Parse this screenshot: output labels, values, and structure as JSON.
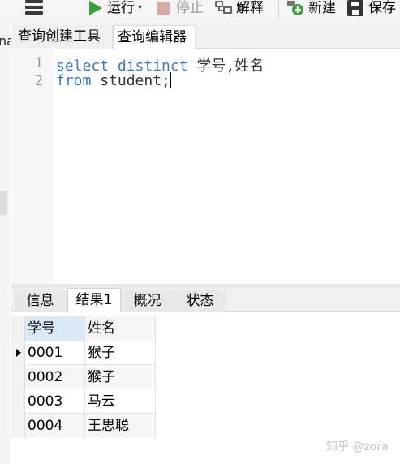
{
  "toolbar": {
    "run_label": "运行",
    "stop_label": "停止",
    "explain_label": "解释",
    "new_label": "新建",
    "save_label": "保存",
    "icons": [
      "menu-icon",
      "run-icon",
      "dropdown-caret-icon",
      "stop-icon",
      "explain-icon",
      "new-icon",
      "save-icon"
    ],
    "colors": {
      "run": "#3aa23a",
      "stop_disabled": "#dba8a8",
      "new": "#3aa23a"
    }
  },
  "left_strip": {
    "partial_text": "na"
  },
  "editor_tabs": [
    {
      "label": "查询创建工具",
      "active": false
    },
    {
      "label": "查询编辑器",
      "active": true
    }
  ],
  "editor": {
    "lines": [
      {
        "number": "1",
        "keyword": "select distinct",
        "rest": " 学号,姓名"
      },
      {
        "number": "2",
        "keyword": "from",
        "rest": " student;"
      }
    ],
    "keyword_color": "#3b76c2"
  },
  "result_tabs": [
    {
      "label": "信息",
      "active": false
    },
    {
      "label": "结果1",
      "active": true
    },
    {
      "label": "概况",
      "active": false
    },
    {
      "label": "状态",
      "active": false
    }
  ],
  "result_grid": {
    "columns": [
      "学号",
      "姓名"
    ],
    "rows": [
      [
        "0001",
        "猴子"
      ],
      [
        "0002",
        "猴子"
      ],
      [
        "0003",
        "马云"
      ],
      [
        "0004",
        "王思聪"
      ]
    ],
    "current_row_index": 0,
    "header_highlight_color": "#dbe8f6"
  },
  "watermark": "知乎 @zora"
}
